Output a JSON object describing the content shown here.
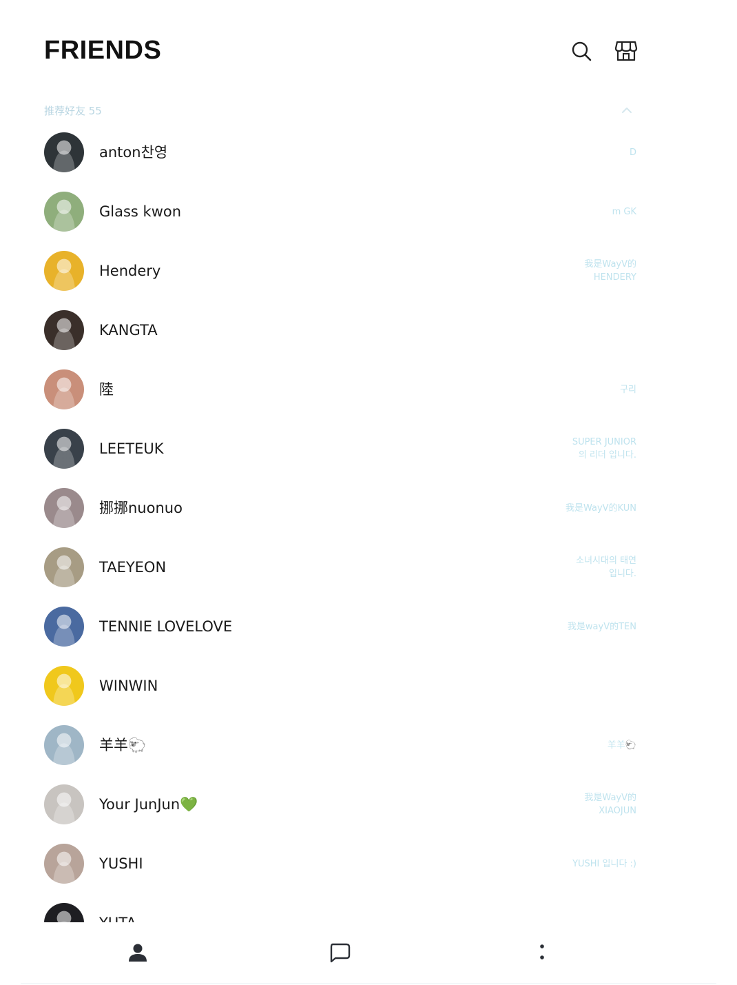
{
  "header": {
    "title": "FRIENDS",
    "search_icon": "search-icon",
    "shop_icon": "shop-icon"
  },
  "section": {
    "label": "推荐好友 55",
    "collapse_icon": "chevron-up-icon"
  },
  "friends": [
    {
      "name": "anton찬영",
      "status": "D",
      "avatar_color": "#2e3438"
    },
    {
      "name": "Glass kwon",
      "status": "m GK",
      "avatar_color": "#8fae7c"
    },
    {
      "name": "Hendery",
      "status": "我是WayV的\nHENDERY",
      "avatar_color": "#e8b22a"
    },
    {
      "name": "KANGTA",
      "status": "",
      "avatar_color": "#3a2f2a"
    },
    {
      "name": "陸",
      "status": "구리",
      "avatar_color": "#c98f7a"
    },
    {
      "name": "LEETEUK",
      "status": "SUPER JUNIOR\n의 리더 입니다.",
      "avatar_color": "#39414a"
    },
    {
      "name": "挪挪nuonuo",
      "status": "我是WayV的KUN",
      "avatar_color": "#9a8a8c"
    },
    {
      "name": "TAEYEON",
      "status": "소녀시대의 태연\n입니다.",
      "avatar_color": "#a79c84"
    },
    {
      "name": "TENNIE LOVELOVE",
      "status": "我是wayV的TEN",
      "avatar_color": "#4a6aa0"
    },
    {
      "name": "WINWIN",
      "status": "",
      "avatar_color": "#f0c81c"
    },
    {
      "name": "羊羊🐑",
      "status": "羊羊🐑",
      "avatar_color": "#9fb6c6"
    },
    {
      "name": "Your JunJun💚",
      "status": "我是WayV的\nXIAOJUN",
      "avatar_color": "#c8c4c0"
    },
    {
      "name": "YUSHI",
      "status": "YUSHI 입니다 :)",
      "avatar_color": "#b8a49a"
    },
    {
      "name": "YUTA",
      "status": "",
      "avatar_color": "#1e1e22"
    }
  ],
  "navbar": {
    "friends_icon": "person-icon",
    "chats_icon": "chat-bubble-icon",
    "more_icon": "more-dots-icon"
  }
}
